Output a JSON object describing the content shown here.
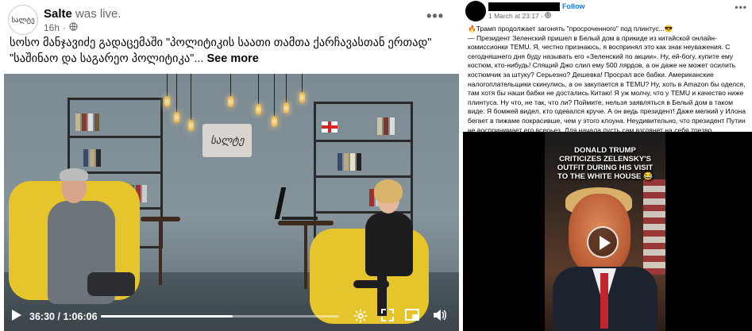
{
  "left_post": {
    "author": "Salte",
    "status": "was live.",
    "time": "16h",
    "visibility_icon": "globe-icon",
    "text": "სოსო მანჯავიძე გადაცემაში \"პოლიტიკის საათი თამთა ქარჩავასთან ერთად\" \"საშინაო და საგარეო პოლიტიკა\"...",
    "see_more": "See more",
    "avatar_text": "სალტე",
    "video": {
      "logo_text": "სალტე",
      "current_time": "36:30",
      "separator": "/",
      "duration": "1:06:06",
      "progress": 0.552
    }
  },
  "right_post": {
    "follow_label": "Follow",
    "date": "1 March at 23:17",
    "text_lines": [
      "🔥Трамп продолжает загонять \"просроченного\" под плинтус...😎",
      "— Президент Зеленский пришел в Белый дом в прикиде из китайской онлайн-комиссионки TEMU. Я, честно признаюсь, я воспринял это как знак неуважения. С сегодняшнего дня буду называть его «Зеленский по акции». Ну, ей-богу, купите ему костюм, кто-нибудь! Спящий Джо слил ему 500 лярдов, а он даже не может осилить костюмчик за штуку? Серьезно? Дешевка! Просрал все бабки. Американские налогоплательщики скинулись, а он закупается в TEMU? Ну, хоть в Amazon бы оделся, там хотя бы наши бабки не достались Китаю! Я уж молчу, что у TEMU и качество ниже плинтуса. Ну что, не так, что ли? Поймите, нельзя заявляться в Белый дом в таком виде. Я бомжей видел, кто одевался круче. А он ведь президент! Даже мелкий у Илона бегает в пижаме покрасивше, чем у этого клоуна. Неудивительно, что президент Путин не воспринимает его всерьез. Для начала пусть сам взглянет на себя трезво."
    ],
    "video": {
      "caption": "DONALD TRUMP CRITICIZES ZELENSKY'S OUTFIT DURING HIS VISIT TO THE WHITE HOUSE 😂"
    }
  }
}
